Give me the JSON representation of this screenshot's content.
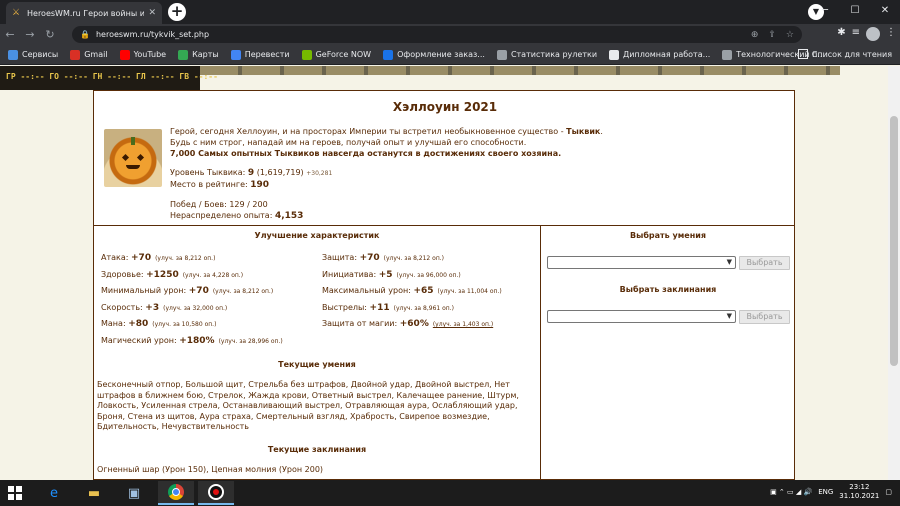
{
  "browser": {
    "tab_title": "HeroesWM.ru Герои войны и де",
    "url": "heroeswm.ru/tykvik_set.php",
    "bookmarks": [
      {
        "label": "Сервисы",
        "icon": "apps-grid-icon",
        "color": "#4a90e2"
      },
      {
        "label": "Gmail",
        "icon": "gmail-icon",
        "color": "#d93025"
      },
      {
        "label": "YouTube",
        "icon": "youtube-icon",
        "color": "#ff0000"
      },
      {
        "label": "Карты",
        "icon": "maps-icon",
        "color": "#34a853"
      },
      {
        "label": "Перевести",
        "icon": "translate-icon",
        "color": "#4285f4"
      },
      {
        "label": "GeForce NOW",
        "icon": "geforce-icon",
        "color": "#76b900"
      },
      {
        "label": "Оформление заказ...",
        "icon": "document-icon",
        "color": "#1a73e8"
      },
      {
        "label": "Статистика рулетки",
        "icon": "globe-icon",
        "color": "#9aa0a6"
      },
      {
        "label": "Дипломная работа...",
        "icon": "diploma-icon",
        "color": "#e8eaed"
      },
      {
        "label": "Технологический п...",
        "icon": "globe-icon",
        "color": "#9aa0a6"
      }
    ],
    "reading_list": "Список для чтения"
  },
  "guild_bar": "ГР --:-- ГО --:-- ГН --:-- ГЛ --:-- ГВ --:--",
  "pet": {
    "title": "Хэллоуин 2021",
    "intro_1": "Герой, сегодня Хеллоуин, и на просторах Империи ты встретил необыкновенное существо - ",
    "intro_name": "Тыквик",
    "intro_2": "Будь с ним строг, нападай им на героев, получай опыт и улучшай его способности.",
    "intro_3": "7,000 Самых опытных Тыквиков навсегда останутся в достижениях своего хозяина.",
    "level_label": "Уровень Тыквика: ",
    "level_value": "9",
    "level_exp": "(1,619,719)",
    "level_delta": "+30,281",
    "rank_label": "Место в рейтинге: ",
    "rank_value": "190",
    "wins_label": "Побед / Боев: 129 / 200",
    "free_exp_label": "Нераспределено опыта: ",
    "free_exp_value": "4,153"
  },
  "improve": {
    "title": "Улучшение характеристик",
    "left": [
      {
        "label": "Атака: ",
        "value": "+70",
        "upgrade": "(улуч. за 8,212 оп.)"
      },
      {
        "label": "Здоровье: ",
        "value": "+1250",
        "upgrade": "(улуч. за 4,228 оп.)"
      },
      {
        "label": "Минимальный урон: ",
        "value": "+70",
        "upgrade": "(улуч. за 8,212 оп.)"
      },
      {
        "label": "Скорость: ",
        "value": "+3",
        "upgrade": "(улуч. за 32,000 оп.)"
      },
      {
        "label": "Мана: ",
        "value": "+80",
        "upgrade": "(улуч. за 10,580 оп.)"
      },
      {
        "label": "Магический урон: ",
        "value": "+180%",
        "upgrade": "(улуч. за 28,996 оп.)"
      }
    ],
    "right": [
      {
        "label": "Защита: ",
        "value": "+70",
        "upgrade": "(улуч. за 8,212 оп.)"
      },
      {
        "label": "Инициатива: ",
        "value": "+5",
        "upgrade": "(улуч. за 96,000 оп.)"
      },
      {
        "label": "Максимальный урон: ",
        "value": "+65",
        "upgrade": "(улуч. за 11,004 оп.)"
      },
      {
        "label": "Выстрелы: ",
        "value": "+11",
        "upgrade": "(улуч. за 8,961 оп.)"
      },
      {
        "label": "Защита от магии: ",
        "value": "+60%",
        "upgrade": "(улуч. за 1,403 оп.)"
      }
    ]
  },
  "skills": {
    "title": "Текущие умения",
    "text": "Бесконечный отпор, Большой щит, Стрельба без штрафов, Двойной удар, Двойной выстрел, Нет штрафов в ближнем бою, Стрелок, Жажда крови, Ответный выстрел, Калечащее ранение, Штурм, Ловкость, Усиленная стрела, Останавливающий выстрел, Отравляющая аура, Ослабляющий удар, Броня, Стена из щитов, Аура страха, Смертельный взгляд, Храбрость, Свирепое возмездие, Бдительность, Нечувствительность"
  },
  "spells": {
    "title": "Текущие заклинания",
    "text": "Огненный шар (Урон 150), Цепная молния (Урон 200)"
  },
  "choose": {
    "skills_title": "Выбрать умения",
    "spells_title": "Выбрать заклинания",
    "button": "Выбрать"
  },
  "taskbar": {
    "lang": "ENG",
    "time": "23:12",
    "date": "31.10.2021"
  }
}
